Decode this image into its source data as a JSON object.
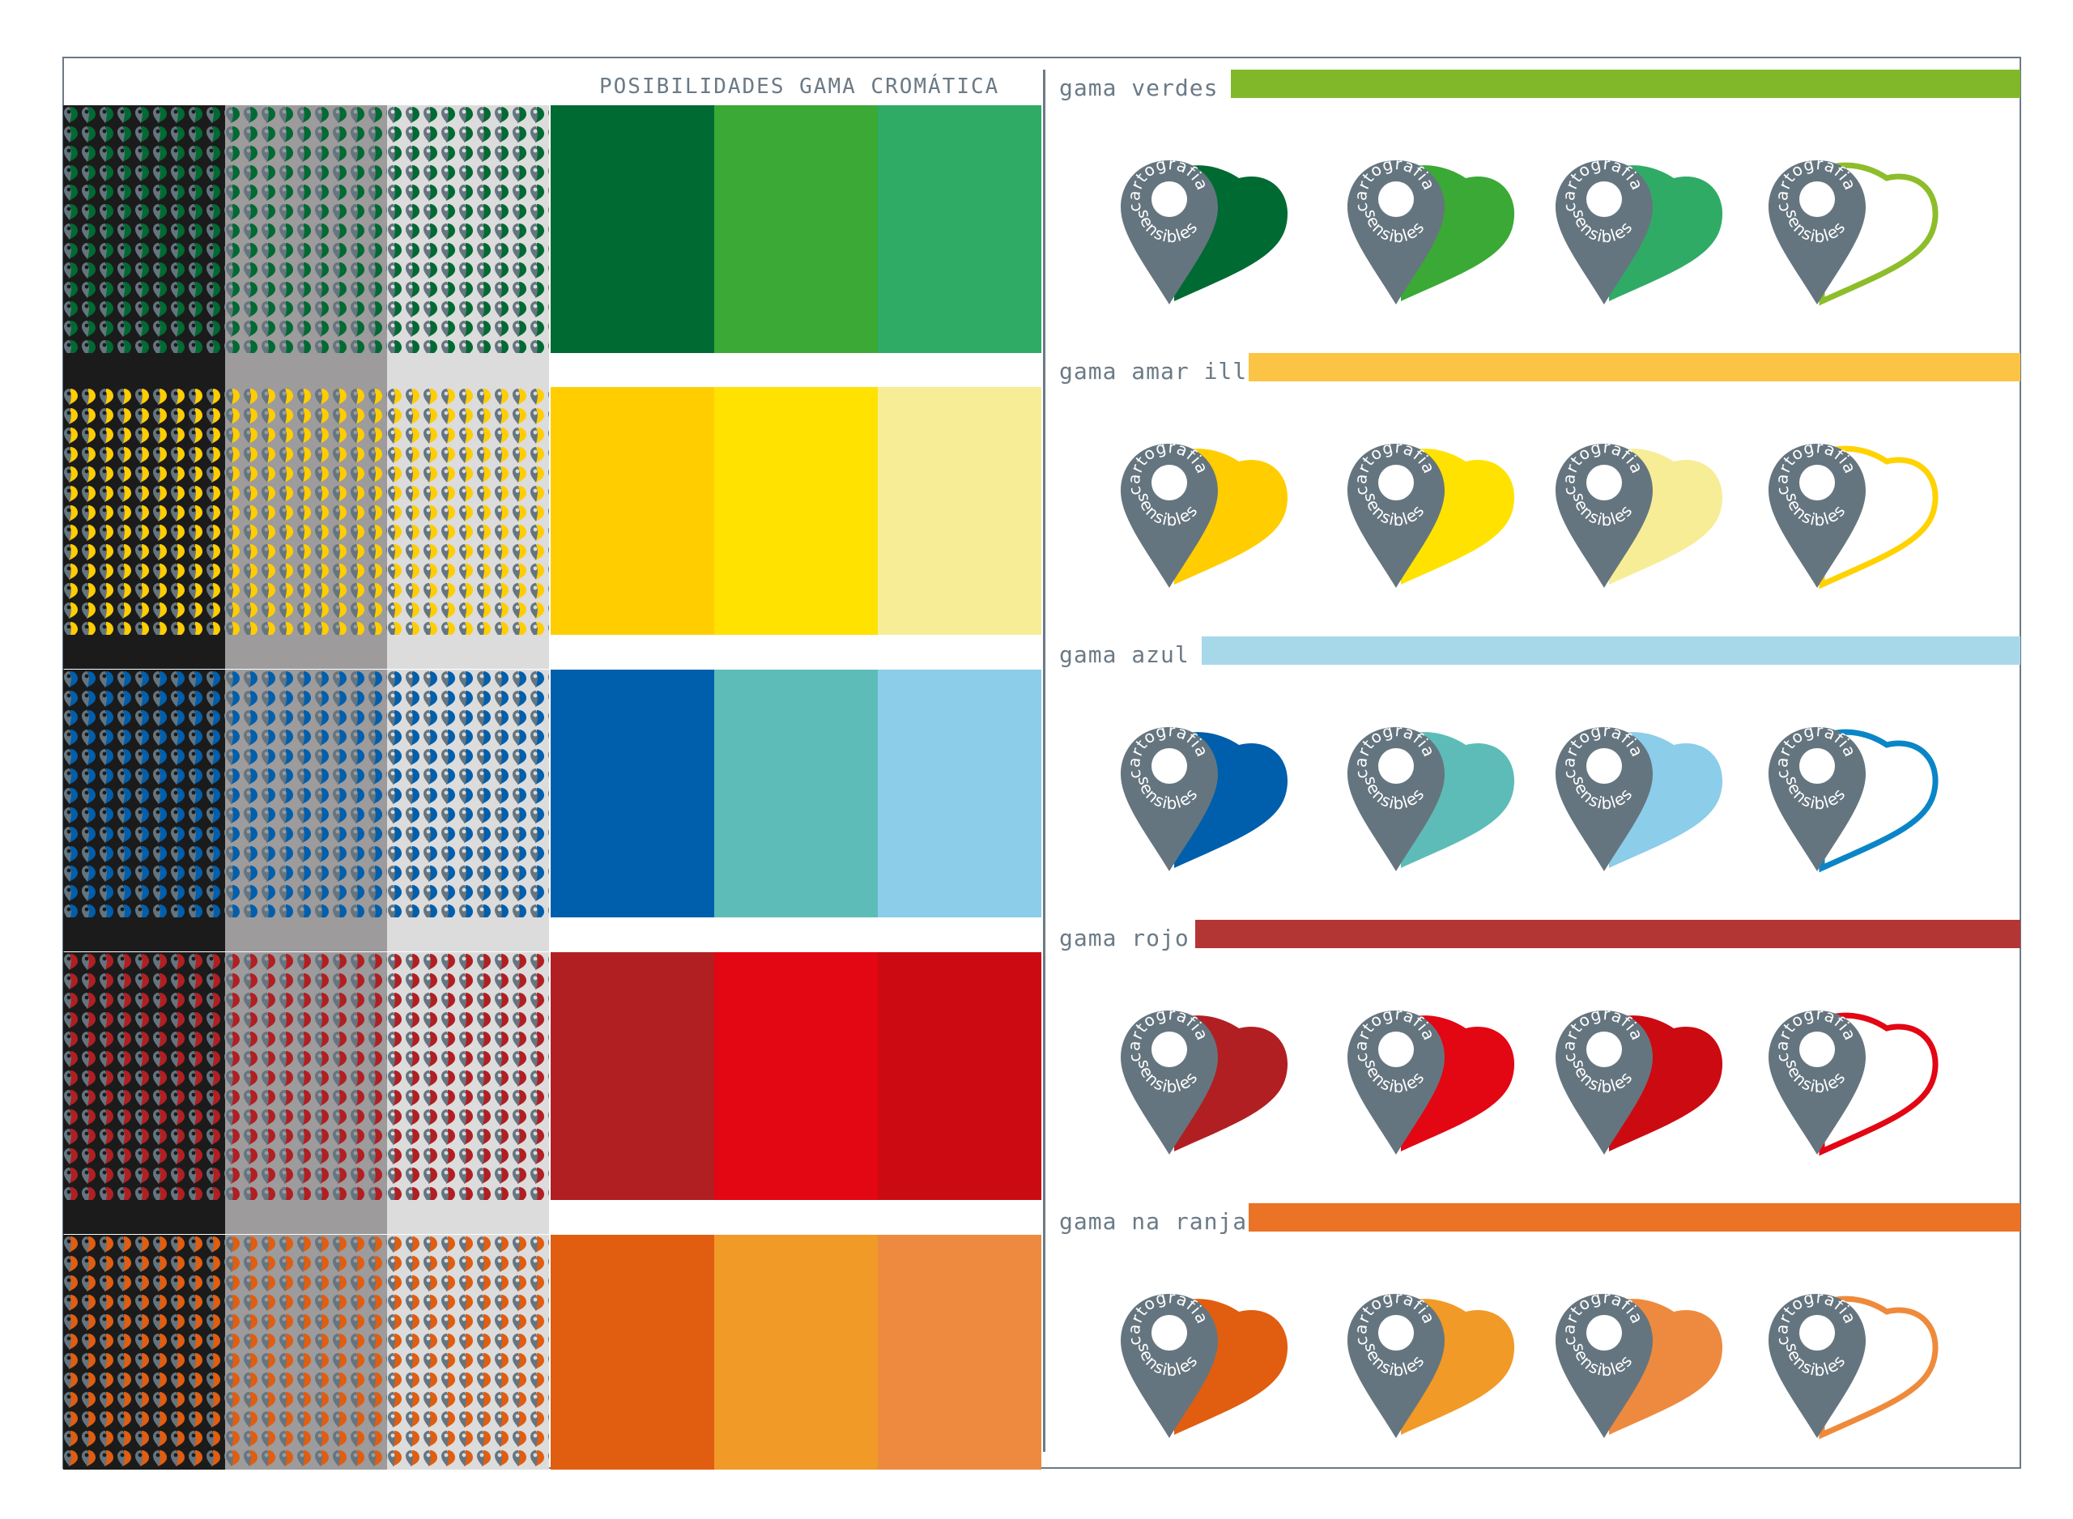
{
  "title": "POSIBILIDADES GAMA CROMÁTICA",
  "logo_text": {
    "top": "cartografias",
    "bottom": "sensibles"
  },
  "pin_color": "#65757f",
  "pattern_backgrounds": [
    "#1b1b1b",
    "#9d9b9c",
    "#dcdcdc"
  ],
  "ranges": [
    {
      "label": "gama verdes",
      "bar_color": "#80b82a",
      "swatches": [
        "#006a33",
        "#3aa935",
        "#2fab66"
      ],
      "outline_color": "#8dbd2a"
    },
    {
      "label": "gama amar illo",
      "bar_color": "#fcc444",
      "swatches": [
        "#ffcd00",
        "#ffe200",
        "#f7ed97"
      ],
      "outline_color": "#ffd200"
    },
    {
      "label": "gama azul",
      "bar_color": "#a6d8ea",
      "swatches": [
        "#005fac",
        "#5dbcb8",
        "#8ccde9"
      ],
      "outline_color": "#0a85c7"
    },
    {
      "label": "gama rojo",
      "bar_color": "#b33635",
      "swatches": [
        "#b11f22",
        "#e30613",
        "#cc0a12"
      ],
      "outline_color": "#e30613"
    },
    {
      "label": "gama na ranja",
      "bar_color": "#ea7325",
      "swatches": [
        "#e15d10",
        "#f19a27",
        "#ee8a3f"
      ],
      "outline_color": "#ef8a3a"
    }
  ]
}
